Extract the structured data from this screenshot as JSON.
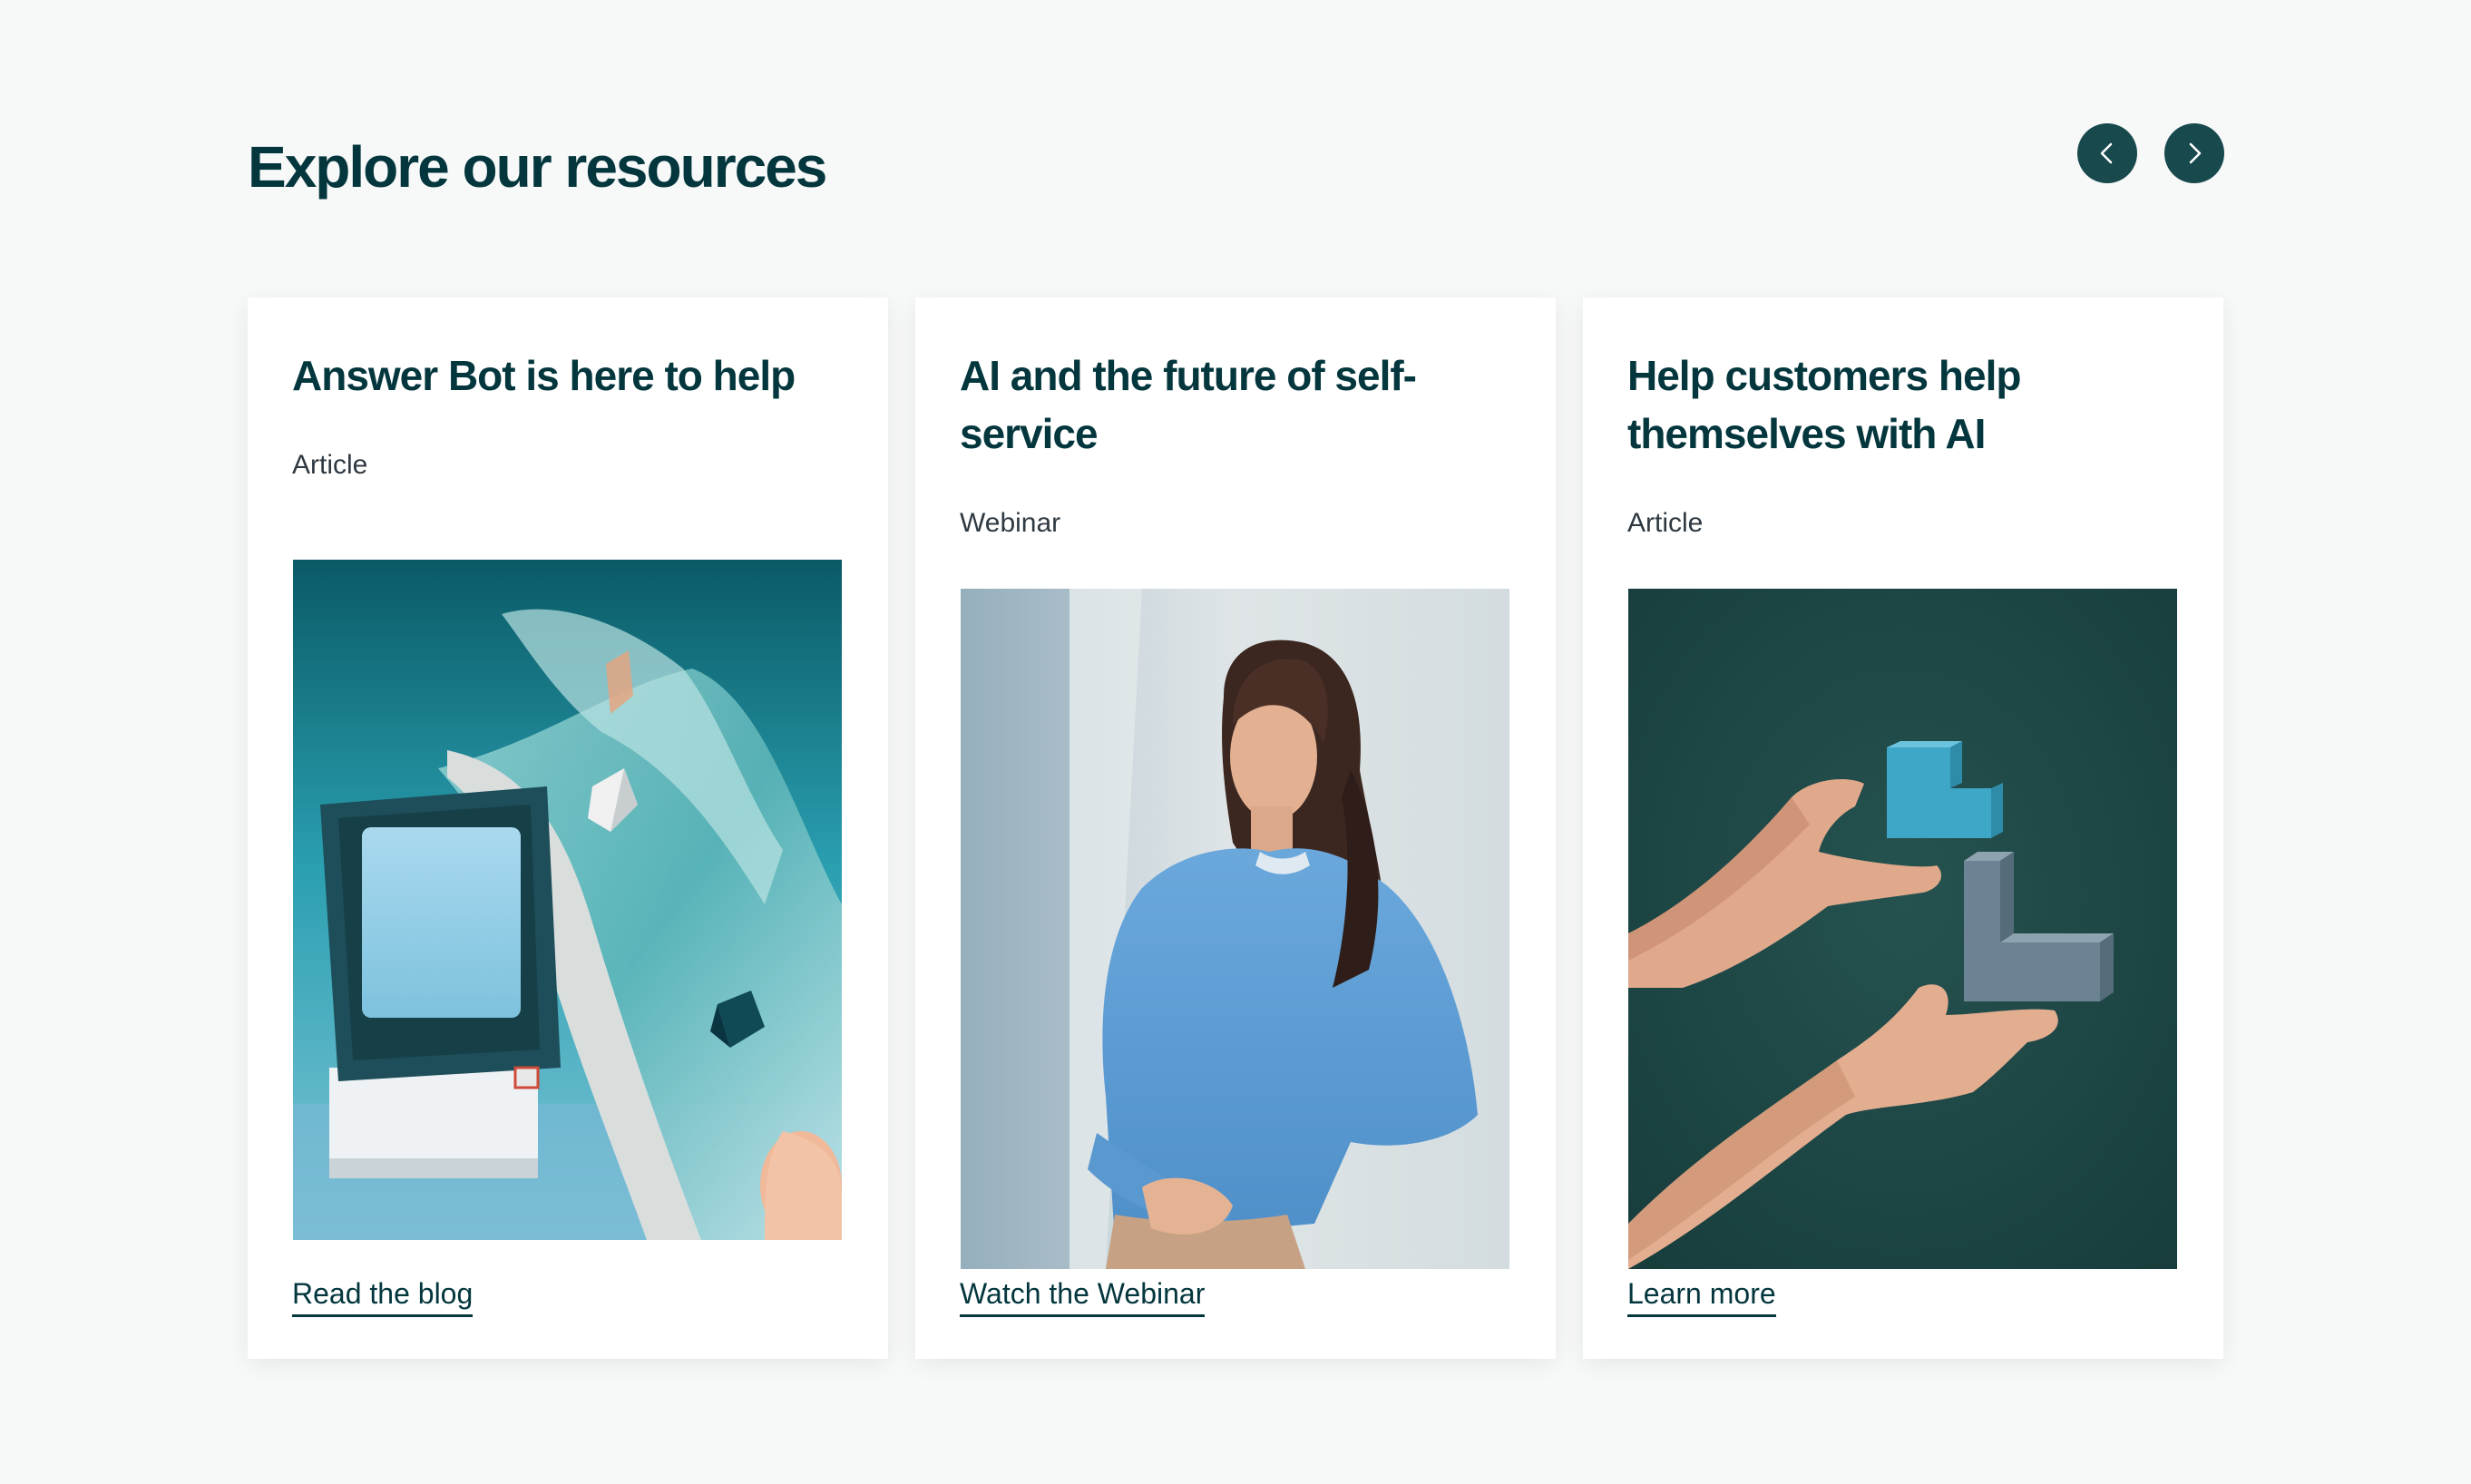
{
  "section": {
    "title": "Explore our resources"
  },
  "carousel": {
    "prev_icon": "chevron-left-icon",
    "next_icon": "chevron-right-icon",
    "button_color": "#17494d"
  },
  "cards": [
    {
      "title": "Answer Bot is here to help",
      "type": "Article",
      "image": "retro-computer-crinkled-foil-image",
      "link": "Read the blog"
    },
    {
      "title": "AI and the future of self-service",
      "type": "Webinar",
      "image": "smiling-woman-blue-sweater-image",
      "link": "Watch the Webinar"
    },
    {
      "title": "Help customers help themselves with AI",
      "type": "Article",
      "image": "hands-holding-blocks-image",
      "link": "Learn more"
    }
  ],
  "colors": {
    "page_background": "#f7f8f8",
    "text_primary": "#03363d",
    "card_background": "#ffffff"
  }
}
